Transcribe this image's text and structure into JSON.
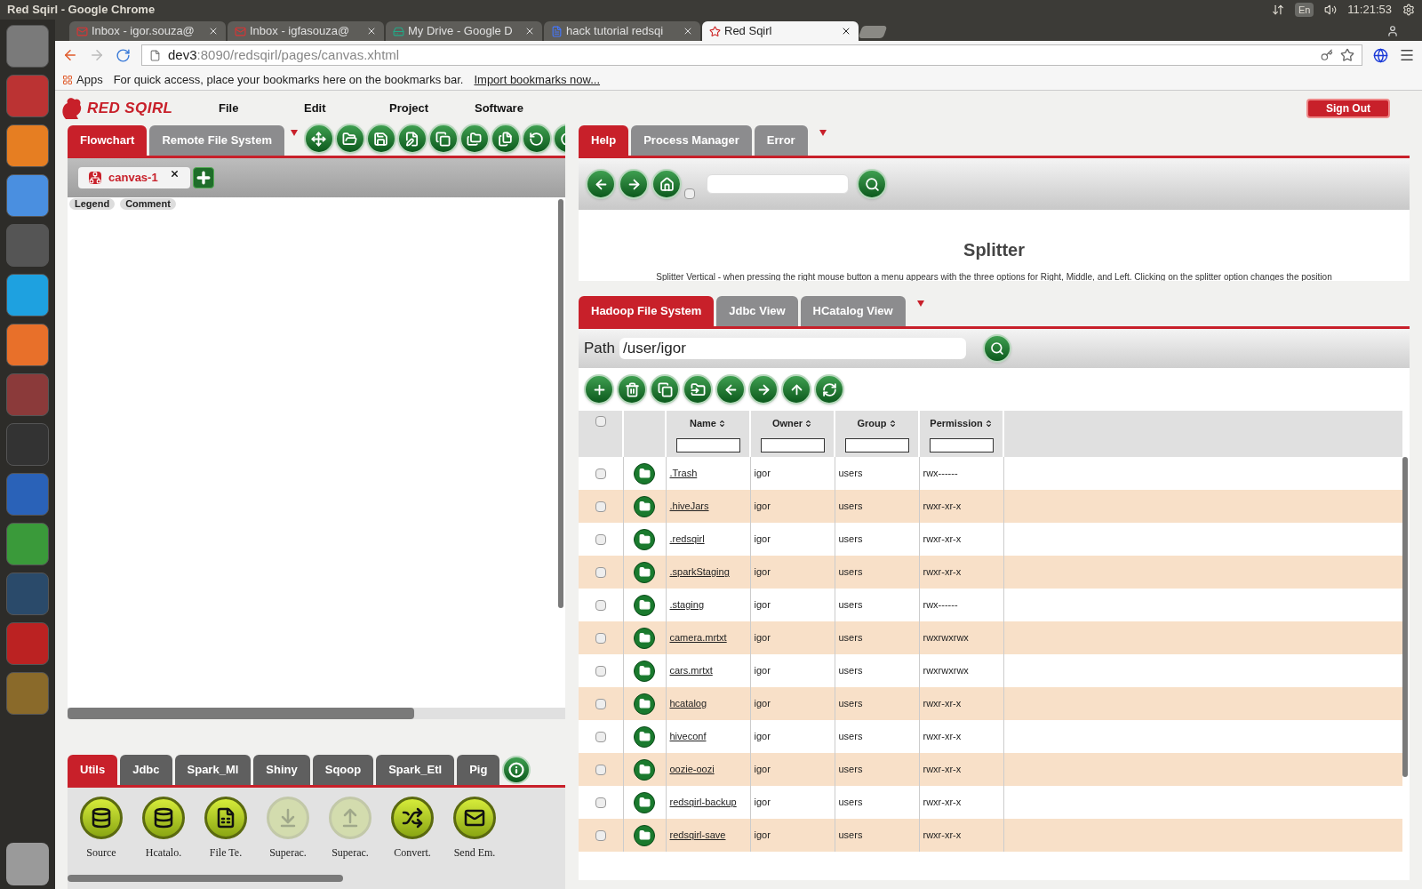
{
  "window": {
    "title": "Red Sqirl - Google Chrome"
  },
  "system_tray": {
    "language": "En",
    "time": "11:21:53"
  },
  "browser_tabs": [
    {
      "title": "Inbox - igor.souza@",
      "selected": false,
      "kind": "mail"
    },
    {
      "title": "Inbox - igfasouza@",
      "selected": false,
      "kind": "mail"
    },
    {
      "title": "My Drive - Google D",
      "selected": false,
      "kind": "drive"
    },
    {
      "title": "hack tutorial redsqi",
      "selected": false,
      "kind": "doc"
    },
    {
      "title": "Red Sqirl",
      "selected": true,
      "kind": "squirrel"
    }
  ],
  "address_bar": {
    "host": "dev3",
    "path": ":8090/redsqirl/pages/canvas.xhtml"
  },
  "bookmarks_bar": {
    "apps": "Apps",
    "hint": "For quick access, place your bookmarks here on the bookmarks bar.",
    "import_link": "Import bookmarks now..."
  },
  "header": {
    "logo": "RED SQIRL",
    "menu": [
      "File",
      "Edit",
      "Project",
      "Software"
    ],
    "sign_out": "Sign Out"
  },
  "flowchart_tabs": [
    {
      "label": "Flowchart",
      "selected": true
    },
    {
      "label": "Remote File System",
      "selected": false
    }
  ],
  "canvas_tabs": [
    {
      "label": "canvas-1",
      "selected": true
    }
  ],
  "canvas_legend": [
    "Legend",
    "Comment"
  ],
  "palette_tabs": [
    {
      "label": "Utils",
      "selected": true
    },
    {
      "label": "Jdbc",
      "selected": false
    },
    {
      "label": "Spark_Ml",
      "selected": false
    },
    {
      "label": "Shiny",
      "selected": false
    },
    {
      "label": "Sqoop",
      "selected": false
    },
    {
      "label": "Spark_Etl",
      "selected": false
    },
    {
      "label": "Pig",
      "selected": false
    }
  ],
  "palette_items": [
    {
      "label": "Source",
      "kind": "database",
      "disabled": false
    },
    {
      "label": "Hcatalo.",
      "kind": "database",
      "disabled": false
    },
    {
      "label": "File Te.",
      "kind": "file",
      "disabled": false
    },
    {
      "label": "Superac.",
      "kind": "import",
      "disabled": true
    },
    {
      "label": "Superac.",
      "kind": "export",
      "disabled": true
    },
    {
      "label": "Convert.",
      "kind": "convert",
      "disabled": false
    },
    {
      "label": "Send Em.",
      "kind": "email",
      "disabled": false
    }
  ],
  "help_tabs": [
    {
      "label": "Help",
      "selected": true
    },
    {
      "label": "Process Manager",
      "selected": false
    },
    {
      "label": "Error",
      "selected": false
    }
  ],
  "help": {
    "checked": false,
    "title": "Splitter",
    "text": "Splitter Vertical - when pressing the right mouse button a menu appears with the three options for Right, Middle, and Left. Clicking on the splitter option changes the position"
  },
  "hdfs_tabs": [
    {
      "label": "Hadoop File System",
      "selected": true
    },
    {
      "label": "Jdbc View",
      "selected": false
    },
    {
      "label": "HCatalog View",
      "selected": false
    }
  ],
  "path": {
    "label": "Path",
    "value": "/user/igor"
  },
  "table": {
    "all_checked": false,
    "columns": [
      "Name",
      "Owner",
      "Group",
      "Permission"
    ],
    "rows": [
      {
        "name": ".Trash",
        "owner": "igor",
        "group": "users",
        "permission": "rwx------",
        "checked": false
      },
      {
        "name": ".hiveJars",
        "owner": "igor",
        "group": "users",
        "permission": "rwxr-xr-x",
        "checked": false
      },
      {
        "name": ".redsqirl",
        "owner": "igor",
        "group": "users",
        "permission": "rwxr-xr-x",
        "checked": false
      },
      {
        "name": ".sparkStaging",
        "owner": "igor",
        "group": "users",
        "permission": "rwxr-xr-x",
        "checked": false
      },
      {
        "name": ".staging",
        "owner": "igor",
        "group": "users",
        "permission": "rwx------",
        "checked": false
      },
      {
        "name": "camera.mrtxt",
        "owner": "igor",
        "group": "users",
        "permission": "rwxrwxrwx",
        "checked": false
      },
      {
        "name": "cars.mrtxt",
        "owner": "igor",
        "group": "users",
        "permission": "rwxrwxrwx",
        "checked": false
      },
      {
        "name": "hcatalog",
        "owner": "igor",
        "group": "users",
        "permission": "rwxr-xr-x",
        "checked": false
      },
      {
        "name": "hiveconf",
        "owner": "igor",
        "group": "users",
        "permission": "rwxr-xr-x",
        "checked": false
      },
      {
        "name": "oozie-oozi",
        "owner": "igor",
        "group": "users",
        "permission": "rwxr-xr-x",
        "checked": false
      },
      {
        "name": "redsqirl-backup",
        "owner": "igor",
        "group": "users",
        "permission": "rwxr-xr-x",
        "checked": false
      },
      {
        "name": "redsqirl-save",
        "owner": "igor",
        "group": "users",
        "permission": "rwxr-xr-x",
        "checked": false
      }
    ]
  }
}
